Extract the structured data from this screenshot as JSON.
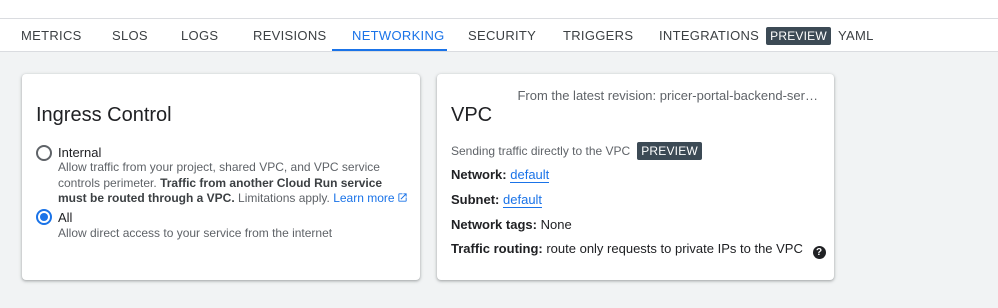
{
  "tabs": [
    {
      "label": "METRICS"
    },
    {
      "label": "SLOS"
    },
    {
      "label": "LOGS"
    },
    {
      "label": "REVISIONS"
    },
    {
      "label": "NETWORKING",
      "active": true
    },
    {
      "label": "SECURITY"
    },
    {
      "label": "TRIGGERS"
    },
    {
      "label": "INTEGRATIONS",
      "badge": "PREVIEW"
    },
    {
      "label": "YAML"
    }
  ],
  "ingress": {
    "title": "Ingress Control",
    "options": [
      {
        "label": "Internal",
        "checked": false,
        "desc_plain_1": "Allow traffic from your project, shared VPC, and VPC service controls perimeter.",
        "desc_bold": "Traffic from another Cloud Run service must be routed through a VPC.",
        "desc_plain_2": "Limitations apply.",
        "learn_more": "Learn more"
      },
      {
        "label": "All",
        "checked": true,
        "desc": "Allow direct access to your service from the internet"
      }
    ]
  },
  "vpc": {
    "revision_note": "From the latest revision: pricer-portal-backend-ser…",
    "title": "VPC",
    "sending_text": "Sending traffic directly to the VPC",
    "badge": "PREVIEW",
    "network_label": "Network:",
    "network_value": "default",
    "subnet_label": "Subnet:",
    "subnet_value": "default",
    "tags_label": "Network tags:",
    "tags_value": "None",
    "routing_label": "Traffic routing:",
    "routing_value": "route only requests to private IPs to the VPC",
    "help_icon": "help-circle-icon"
  },
  "colors": {
    "accent": "#1a73e8",
    "badge_bg": "#3c4a55",
    "page_bg": "#f1f3f4"
  }
}
